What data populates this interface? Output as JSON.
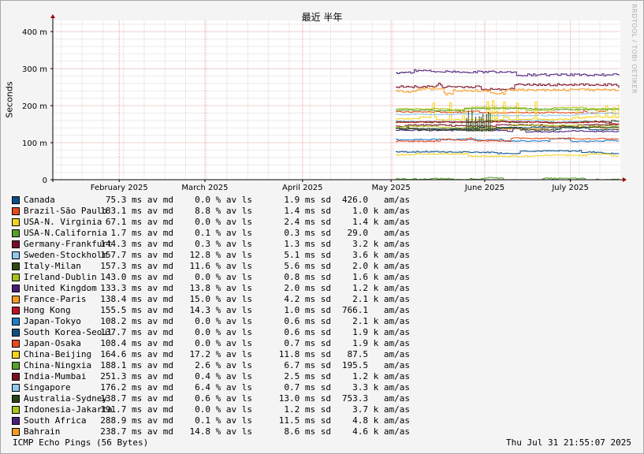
{
  "chart_data": {
    "type": "line",
    "title": "最近 半年",
    "ylabel": "Seconds",
    "ylim": [
      0,
      0.43
    ],
    "y_ticks": [
      "0",
      "100 m",
      "200 m",
      "300 m",
      "400 m"
    ],
    "y_tick_values": [
      0,
      0.1,
      0.2,
      0.3,
      0.4
    ],
    "x_ticks": [
      "February 2025",
      "March 2025",
      "April 2025",
      "May 2025",
      "June 2025",
      "July 2025"
    ],
    "grid": true,
    "data_start_fraction": 0.6,
    "series": [
      {
        "name": "Canada",
        "color": "#0a4f8a",
        "median_ms": 75.3
      },
      {
        "name": "Brazil-São Paulo",
        "color": "#e64a19",
        "median_ms": 183.1
      },
      {
        "name": "USA-N. Virginia",
        "color": "#f2d41f",
        "median_ms": 67.1
      },
      {
        "name": "USA-N.California",
        "color": "#55a02b",
        "median_ms": 1.7
      },
      {
        "name": "Germany-Frankfurt",
        "color": "#7a0b2a",
        "median_ms": 144.3
      },
      {
        "name": "Sweden-Stockholm",
        "color": "#8fc8f0",
        "median_ms": 157.7
      },
      {
        "name": "Italy-Milan",
        "color": "#2e4a12",
        "median_ms": 157.3
      },
      {
        "name": "Ireland-Dublin",
        "color": "#a6c31d",
        "median_ms": 143.0
      },
      {
        "name": "United Kingdom",
        "color": "#4a1e78",
        "median_ms": 133.3
      },
      {
        "name": "France-Paris",
        "color": "#f59a22",
        "median_ms": 138.4
      },
      {
        "name": "Hong Kong",
        "color": "#c0121f",
        "median_ms": 155.5
      },
      {
        "name": "Japan-Tokyo",
        "color": "#1f7fc8",
        "median_ms": 108.2
      },
      {
        "name": "South Korea-Seoul",
        "color": "#0e4f83",
        "median_ms": 137.7
      },
      {
        "name": "Japan-Osaka",
        "color": "#e84a1e",
        "median_ms": 108.4
      },
      {
        "name": "China-Beijing",
        "color": "#f7d31a",
        "median_ms": 164.6
      },
      {
        "name": "China-Ningxia",
        "color": "#5aa02a",
        "median_ms": 188.1
      },
      {
        "name": "India-Mumbai",
        "color": "#7e0d22",
        "median_ms": 251.3
      },
      {
        "name": "Singapore",
        "color": "#90c8f0",
        "median_ms": 176.2
      },
      {
        "name": "Australia-Sydney",
        "color": "#2a4512",
        "median_ms": 138.7
      },
      {
        "name": "Indonesia-Jakarta",
        "color": "#a8c81a",
        "median_ms": 191.7
      },
      {
        "name": "South Africa",
        "color": "#4a1e78",
        "median_ms": 288.9
      },
      {
        "name": "Bahrain",
        "color": "#f59a22",
        "median_ms": 238.7
      }
    ]
  },
  "legend": [
    {
      "name": "Canada",
      "median": "75.3 ms av md",
      "loss": "0.0 % av ls",
      "sd": "1.9 ms sd",
      "am": "426.0   am/as"
    },
    {
      "name": "Brazil-São Paulo",
      "median": "183.1 ms av md",
      "loss": "8.8 % av ls",
      "sd": "1.4 ms sd",
      "am": "1.0 k am/as"
    },
    {
      "name": "USA-N. Virginia",
      "median": "67.1 ms av md",
      "loss": "0.0 % av ls",
      "sd": "2.4 ms sd",
      "am": "1.4 k am/as"
    },
    {
      "name": "USA-N.California",
      "median": "1.7 ms av md",
      "loss": "0.1 % av ls",
      "sd": "0.3 ms sd",
      "am": "29.0   am/as"
    },
    {
      "name": "Germany-Frankfurt",
      "median": "144.3 ms av md",
      "loss": "0.3 % av ls",
      "sd": "1.3 ms sd",
      "am": "3.2 k am/as"
    },
    {
      "name": "Sweden-Stockholm",
      "median": "157.7 ms av md",
      "loss": "12.8 % av ls",
      "sd": "5.1 ms sd",
      "am": "3.6 k am/as"
    },
    {
      "name": "Italy-Milan",
      "median": "157.3 ms av md",
      "loss": "11.6 % av ls",
      "sd": "5.6 ms sd",
      "am": "2.0 k am/as"
    },
    {
      "name": "Ireland-Dublin",
      "median": "143.0 ms av md",
      "loss": "0.0 % av ls",
      "sd": "0.8 ms sd",
      "am": "1.6 k am/as"
    },
    {
      "name": "United Kingdom",
      "median": "133.3 ms av md",
      "loss": "13.8 % av ls",
      "sd": "2.0 ms sd",
      "am": "1.2 k am/as"
    },
    {
      "name": "France-Paris",
      "median": "138.4 ms av md",
      "loss": "15.0 % av ls",
      "sd": "4.2 ms sd",
      "am": "2.1 k am/as"
    },
    {
      "name": "Hong Kong",
      "median": "155.5 ms av md",
      "loss": "14.3 % av ls",
      "sd": "1.0 ms sd",
      "am": "766.1   am/as"
    },
    {
      "name": "Japan-Tokyo",
      "median": "108.2 ms av md",
      "loss": "0.0 % av ls",
      "sd": "0.6 ms sd",
      "am": "2.1 k am/as"
    },
    {
      "name": "South Korea-Seoul",
      "median": "137.7 ms av md",
      "loss": "0.0 % av ls",
      "sd": "0.6 ms sd",
      "am": "1.9 k am/as"
    },
    {
      "name": "Japan-Osaka",
      "median": "108.4 ms av md",
      "loss": "0.0 % av ls",
      "sd": "0.7 ms sd",
      "am": "1.9 k am/as"
    },
    {
      "name": "China-Beijing",
      "median": "164.6 ms av md",
      "loss": "17.2 % av ls",
      "sd": "11.8 ms sd",
      "am": "87.5   am/as"
    },
    {
      "name": "China-Ningxia",
      "median": "188.1 ms av md",
      "loss": "2.6 % av ls",
      "sd": "6.7 ms sd",
      "am": "195.5   am/as"
    },
    {
      "name": "India-Mumbai",
      "median": "251.3 ms av md",
      "loss": "0.4 % av ls",
      "sd": "2.5 ms sd",
      "am": "1.2 k am/as"
    },
    {
      "name": "Singapore",
      "median": "176.2 ms av md",
      "loss": "6.4 % av ls",
      "sd": "0.7 ms sd",
      "am": "3.3 k am/as"
    },
    {
      "name": "Australia-Sydney",
      "median": "138.7 ms av md",
      "loss": "0.6 % av ls",
      "sd": "13.0 ms sd",
      "am": "753.3   am/as"
    },
    {
      "name": "Indonesia-Jakarta",
      "median": "191.7 ms av md",
      "loss": "0.0 % av ls",
      "sd": "1.2 ms sd",
      "am": "3.7 k am/as"
    },
    {
      "name": "South Africa",
      "median": "288.9 ms av md",
      "loss": "0.1 % av ls",
      "sd": "11.5 ms sd",
      "am": "4.8 k am/as"
    },
    {
      "name": "Bahrain",
      "median": "238.7 ms av md",
      "loss": "14.8 % av ls",
      "sd": "8.6 ms sd",
      "am": "4.6 k am/as"
    }
  ],
  "footer": {
    "left": "ICMP Echo Pings (56 Bytes)",
    "right": "Thu Jul 31 21:55:07 2025"
  },
  "watermark": "RRDTOOL / TOBI OETIKER",
  "colors": {
    "grid_major": "#e8a0a0",
    "grid_minor": "#d8d8d8",
    "axis": "#000000",
    "arrow": "#a00000"
  }
}
